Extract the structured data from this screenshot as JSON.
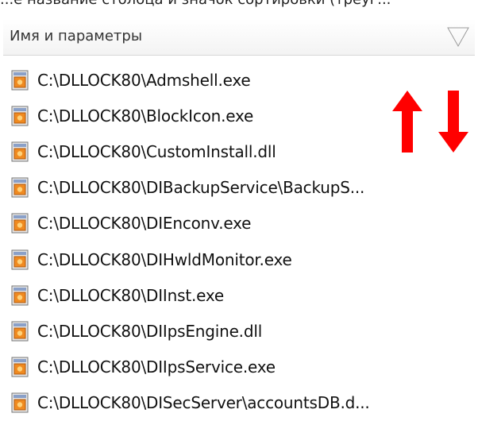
{
  "caption": "...е название столбца и значок сортировки (треуг...",
  "header": {
    "label": "Имя и параметры",
    "sort_icon": "triangle-sort-icon"
  },
  "rows": [
    {
      "path": "C:\\DLLOCK80\\Admshell.exe"
    },
    {
      "path": "C:\\DLLOCK80\\BlockIcon.exe"
    },
    {
      "path": "C:\\DLLOCK80\\CustomInstall.dll"
    },
    {
      "path": "C:\\DLLOCK80\\DIBackupService\\BackupS..."
    },
    {
      "path": "C:\\DLLOCK80\\DIEnconv.exe"
    },
    {
      "path": "C:\\DLLOCK80\\DIHwldMonitor.exe"
    },
    {
      "path": "C:\\DLLOCK80\\DIInst.exe"
    },
    {
      "path": "C:\\DLLOCK80\\DIIpsEngine.dll"
    },
    {
      "path": "C:\\DLLOCK80\\DIIpsService.exe"
    },
    {
      "path": "C:\\DLLOCK80\\DISecServer\\accountsDB.d..."
    }
  ],
  "annotation": {
    "up_arrow_color": "#ff0000",
    "down_arrow_color": "#ff0000"
  }
}
